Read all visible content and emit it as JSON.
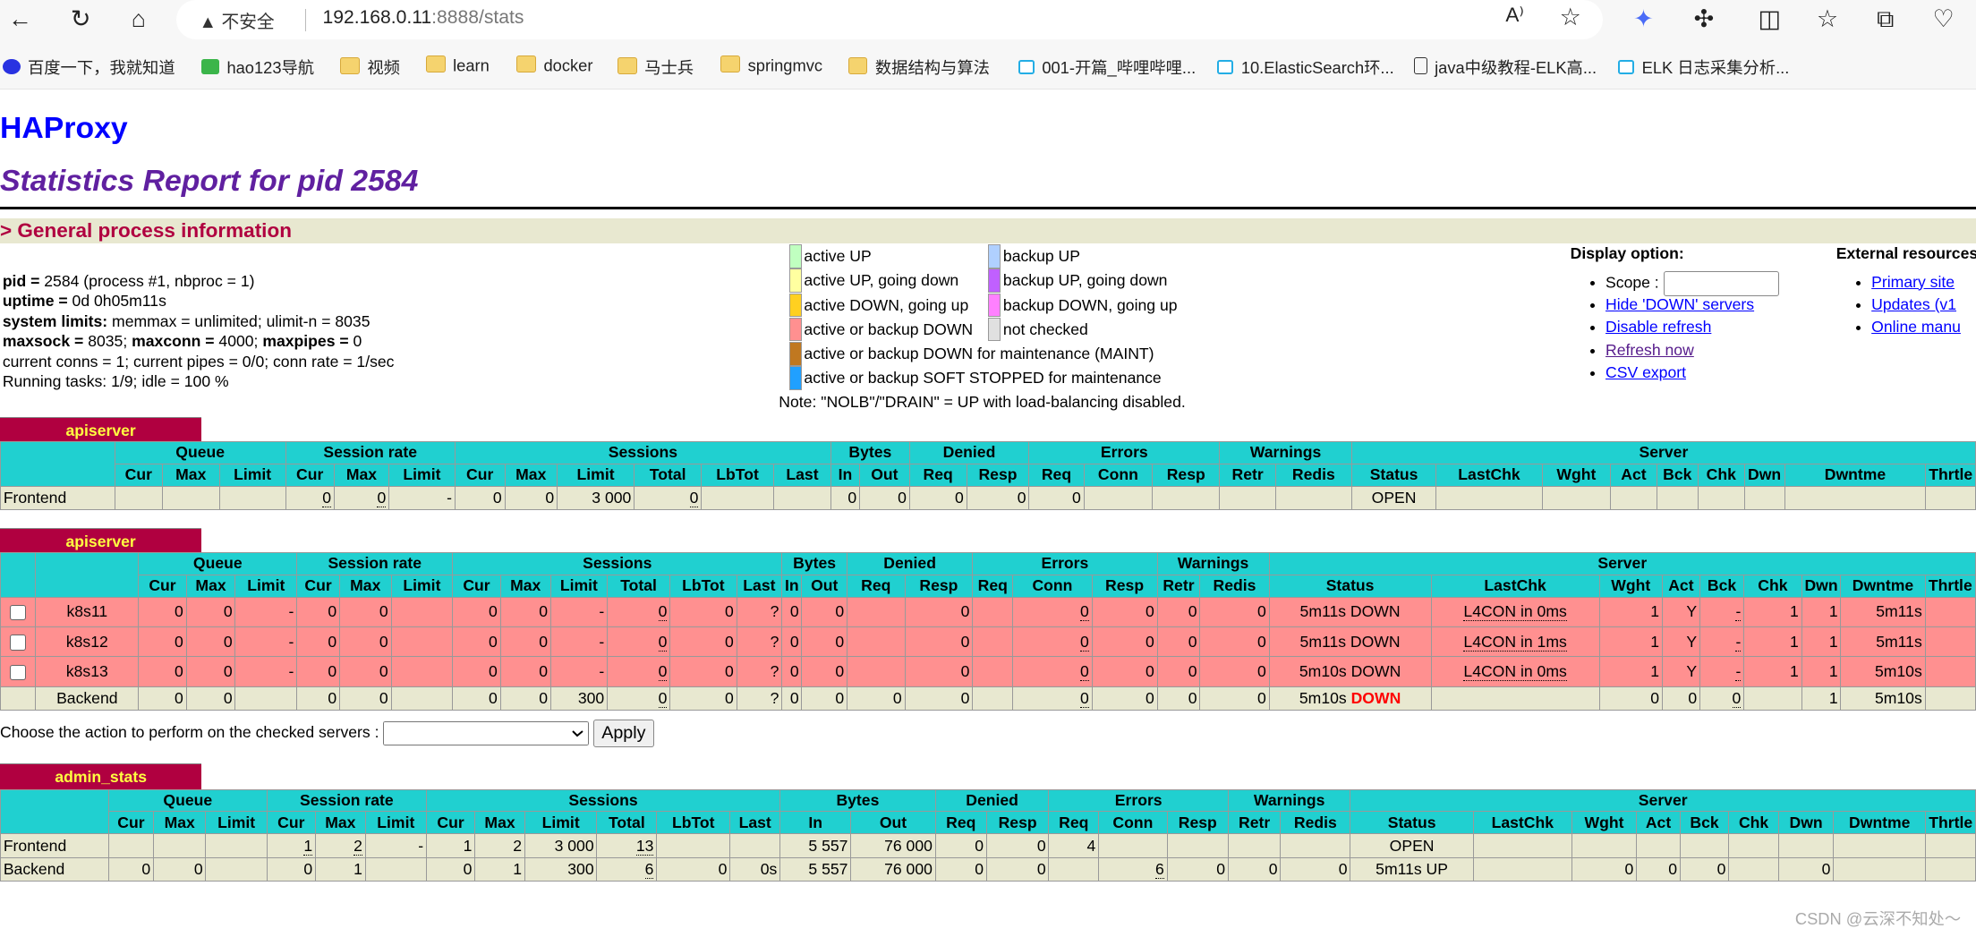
{
  "browser": {
    "security_label": "不安全",
    "url_host": "192.168.0.11",
    "url_rest": ":8888/stats",
    "bookmarks": [
      "百度一下，我就知道",
      "hao123导航",
      "视频",
      "learn",
      "docker",
      "马士兵",
      "springmvc",
      "数据结构与算法",
      "001-开篇_哔哩哔哩...",
      "10.ElasticSearch环...",
      "java中级教程-ELK高...",
      "ELK 日志采集分析..."
    ]
  },
  "header": {
    "title": "HAProxy",
    "subtitle": "Statistics Report for pid 2584",
    "section": "> General process information"
  },
  "info": {
    "lines": [
      {
        "b": "pid = ",
        "t": "2584 (process #1, nbproc = 1)"
      },
      {
        "b": "uptime = ",
        "t": "0d 0h05m11s"
      },
      {
        "b": "system limits:",
        "t": " memmax = unlimited; ulimit-n = 8035"
      },
      {
        "b": "maxsock = ",
        "t": "8035; ",
        "b2": "maxconn = ",
        "t2": "4000; ",
        "b3": "maxpipes = ",
        "t3": "0"
      },
      {
        "t": "current conns = 1; current pipes = 0/0; conn rate = 1/sec"
      },
      {
        "t": "Running tasks: 1/9; idle = 100 %"
      }
    ]
  },
  "legend": {
    "items": [
      {
        "label": "active UP",
        "color": "#c0ffc0"
      },
      {
        "label": "backup UP",
        "color": "#b0d0ff"
      },
      {
        "label": "active UP, going down",
        "color": "#ffffa0"
      },
      {
        "label": "backup UP, going down",
        "color": "#c060ff"
      },
      {
        "label": "active DOWN, going up",
        "color": "#ffd020"
      },
      {
        "label": "backup DOWN, going up",
        "color": "#ff80ff"
      },
      {
        "label": "active or backup DOWN",
        "color": "#ff9090"
      },
      {
        "label": "not checked",
        "color": "#e0e0e0"
      },
      {
        "label": "active or backup DOWN for maintenance (MAINT)",
        "color": "#c07820"
      },
      {
        "label": "active or backup SOFT STOPPED for maintenance",
        "color": "#20a0ff"
      }
    ],
    "note": "Note: \"NOLB\"/\"DRAIN\" = UP with load-balancing disabled."
  },
  "display_option": {
    "title": "Display option:",
    "scope_label": "Scope :",
    "scope_value": "",
    "links": [
      "Hide 'DOWN' servers",
      "Disable refresh",
      "Refresh now",
      "CSV export"
    ]
  },
  "external": {
    "title": "External resources:",
    "links": [
      "Primary site",
      "Updates (v1",
      "Online manu"
    ]
  },
  "columns": {
    "groups": [
      "Queue",
      "Session rate",
      "Sessions",
      "Bytes",
      "Denied",
      "Errors",
      "Warnings",
      "Server"
    ],
    "sub": [
      "Cur",
      "Max",
      "Limit",
      "Cur",
      "Max",
      "Limit",
      "Cur",
      "Max",
      "Limit",
      "Total",
      "LbTot",
      "Last",
      "In",
      "Out",
      "Req",
      "Resp",
      "Req",
      "Conn",
      "Resp",
      "Retr",
      "Redis",
      "Status",
      "LastChk",
      "Wght",
      "Act",
      "Bck",
      "Chk",
      "Dwn",
      "Dwntme",
      "Thrtle"
    ]
  },
  "proxies": [
    {
      "name": "apiserver",
      "rows": [
        {
          "type": "fe",
          "cells": [
            "Frontend",
            "",
            "",
            "",
            "0",
            "0",
            "-",
            "0",
            "0",
            "3 000",
            "0",
            "",
            "",
            "0",
            "0",
            "0",
            "0",
            "0",
            "",
            "",
            "",
            "",
            "OPEN",
            "",
            "",
            "",
            "",
            "",
            "",
            "",
            ""
          ]
        }
      ]
    },
    {
      "name": "apiserver",
      "rows": [
        {
          "type": "down",
          "cells": [
            "k8s11",
            "0",
            "0",
            "-",
            "0",
            "0",
            "",
            "0",
            "0",
            "-",
            "0",
            "0",
            "?",
            "0",
            "0",
            "",
            "0",
            "",
            "0",
            "0",
            "0",
            "0",
            "5m11s DOWN",
            "L4CON in 0ms",
            "1",
            "Y",
            "-",
            "1",
            "1",
            "5m11s",
            ""
          ]
        },
        {
          "type": "down",
          "cells": [
            "k8s12",
            "0",
            "0",
            "-",
            "0",
            "0",
            "",
            "0",
            "0",
            "-",
            "0",
            "0",
            "?",
            "0",
            "0",
            "",
            "0",
            "",
            "0",
            "0",
            "0",
            "0",
            "5m11s DOWN",
            "L4CON in 1ms",
            "1",
            "Y",
            "-",
            "1",
            "1",
            "5m11s",
            ""
          ]
        },
        {
          "type": "down",
          "cells": [
            "k8s13",
            "0",
            "0",
            "-",
            "0",
            "0",
            "",
            "0",
            "0",
            "-",
            "0",
            "0",
            "?",
            "0",
            "0",
            "",
            "0",
            "",
            "0",
            "0",
            "0",
            "0",
            "5m10s DOWN",
            "L4CON in 0ms",
            "1",
            "Y",
            "-",
            "1",
            "1",
            "5m10s",
            ""
          ]
        },
        {
          "type": "be",
          "cells": [
            "Backend",
            "0",
            "0",
            "",
            "0",
            "0",
            "",
            "0",
            "0",
            "300",
            "0",
            "0",
            "?",
            "0",
            "0",
            "0",
            "0",
            "",
            "0",
            "0",
            "0",
            "0",
            {
              "t": "5m10s ",
              "red": "DOWN"
            },
            "",
            "0",
            "0",
            "0",
            "",
            "1",
            "5m10s",
            ""
          ]
        }
      ],
      "action_label": "Choose the action to perform on the checked servers :",
      "action_select": "",
      "apply_label": "Apply"
    },
    {
      "name": "admin_stats",
      "rows": [
        {
          "type": "fe",
          "cells": [
            "Frontend",
            "",
            "",
            "",
            "1",
            "2",
            "-",
            "1",
            "2",
            "3 000",
            "13",
            "",
            "",
            "5 557",
            "76 000",
            "0",
            "0",
            "4",
            "",
            "",
            "",
            "",
            "OPEN",
            "",
            "",
            "",
            "",
            "",
            "",
            "",
            ""
          ]
        },
        {
          "type": "be",
          "cells": [
            "Backend",
            "0",
            "0",
            "",
            "0",
            "1",
            "",
            "0",
            "1",
            "300",
            "6",
            "0",
            "0s",
            "5 557",
            "76 000",
            "0",
            "0",
            "",
            "6",
            "0",
            "0",
            "0",
            "5m11s UP",
            "",
            "0",
            "0",
            "0",
            "",
            "0",
            "",
            ""
          ]
        }
      ]
    }
  ],
  "watermark": "CSDN @云深不知处～"
}
